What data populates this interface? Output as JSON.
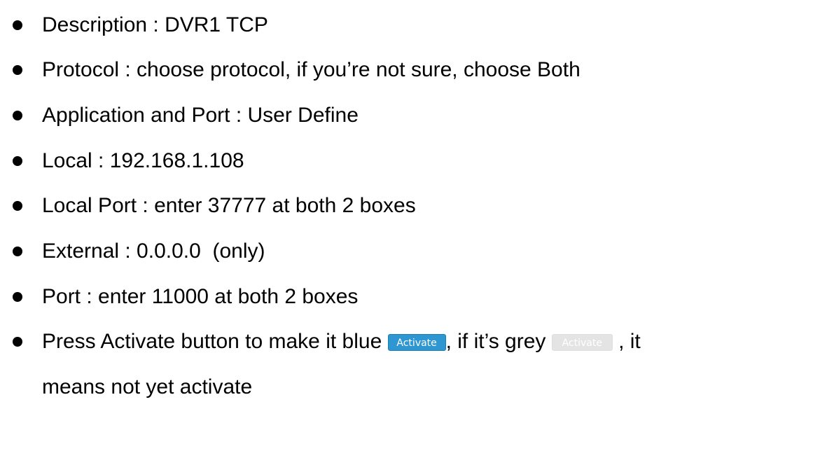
{
  "bullets": [
    {
      "text": "Description : DVR1 TCP"
    },
    {
      "text": "Protocol : choose protocol, if you’re not sure, choose Both"
    },
    {
      "text": "Application and Port : User Define"
    },
    {
      "text": "Local : 192.168.1.108"
    },
    {
      "text": "Local Port : enter 37777 at both 2 boxes"
    },
    {
      "text": "External : 0.0.0.0  (only)"
    },
    {
      "text": "Port : enter 11000 at both 2 boxes"
    },
    {
      "part1": "Press Activate button to make it blue ",
      "blue_button_label": "Activate",
      "part2": ", if it’s grey ",
      "grey_button_label": "Activate",
      "part3": " , it",
      "continuation": "means not yet activate"
    }
  ],
  "colors": {
    "blue_button": "#2e96d0",
    "grey_button": "#e4e4e4"
  },
  "icons": {
    "bullet": "bullet-dot-icon"
  }
}
